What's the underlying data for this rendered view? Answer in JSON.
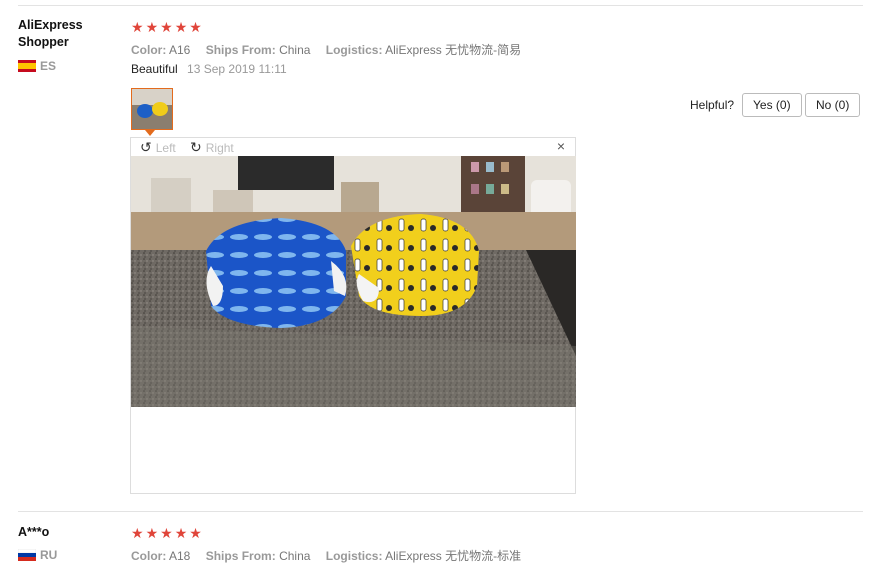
{
  "reviews": [
    {
      "author_line1": "AliExpress",
      "author_line2": "Shopper",
      "country_code": "ES",
      "rating": 5,
      "color_label": "Color:",
      "color_value": "A16",
      "ships_label": "Ships From:",
      "ships_value": "China",
      "logistics_label": "Logistics:",
      "logistics_value": "AliExpress 无忧物流-简易",
      "comment": "Beautiful",
      "date": "13 Sep 2019 11:11",
      "helpful_label": "Helpful?",
      "yes_label": "Yes (0)",
      "no_label": "No (0)",
      "viewer": {
        "left_label": "Left",
        "right_label": "Right",
        "close_icon": "×"
      }
    },
    {
      "author_line1": "A***o",
      "country_code": "RU",
      "rating": 5,
      "color_label": "Color:",
      "color_value": "A18",
      "ships_label": "Ships From:",
      "ships_value": "China",
      "logistics_label": "Logistics:",
      "logistics_value": "AliExpress 无忧物流-标准"
    }
  ],
  "colors": {
    "star": "#e0453a",
    "thumb_border": "#e36b1d"
  },
  "icons": [
    "star-icon",
    "rotate-left-icon",
    "rotate-right-icon",
    "close-icon",
    "flag-es-icon",
    "flag-ru-icon"
  ]
}
